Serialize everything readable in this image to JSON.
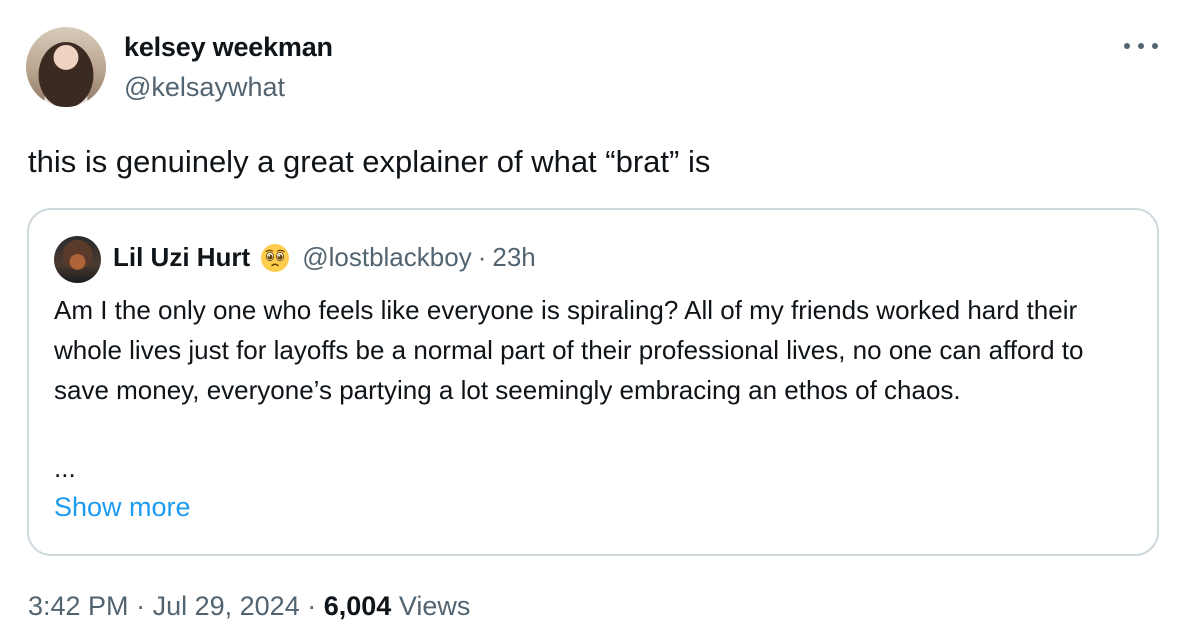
{
  "author": {
    "name": "kelsey weekman",
    "handle": "@kelsaywhat"
  },
  "tweet": {
    "text": "this is genuinely a great explainer of what “brat” is"
  },
  "quote": {
    "name": "Lil Uzi Hurt",
    "emoji_icon": "pleading-face-icon",
    "handle": "@lostblackboy",
    "separator": "·",
    "time": "23h",
    "text": "Am I the only one who feels like everyone is spiraling? All of my friends worked hard their whole lives just for layoffs be a normal part of their professional lives, no one can afford to save money, everyone’s partying a lot seemingly embracing an ethos of chaos.",
    "ellipsis": "...",
    "show_more": "Show more"
  },
  "meta": {
    "time": "3:42 PM",
    "separator": "·",
    "date": "Jul 29, 2024",
    "views_count": "6,004",
    "views_label": "Views"
  },
  "colors": {
    "text": "#0f1419",
    "secondary": "#536471",
    "link": "#1d9bf0",
    "border": "#cfd9de"
  }
}
